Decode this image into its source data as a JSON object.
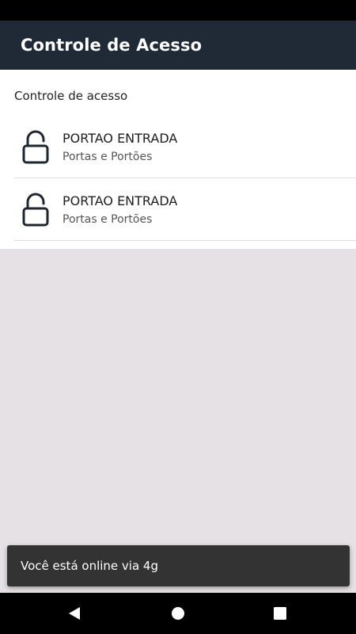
{
  "app_bar": {
    "title": "Controle de Acesso"
  },
  "section": {
    "header": "Controle de acesso"
  },
  "items": [
    {
      "title": "PORTAO ENTRADA",
      "subtitle": "Portas e Portões",
      "icon": "unlocked-padlock-icon"
    },
    {
      "title": "PORTAO ENTRADA",
      "subtitle": "Portas e Portões",
      "icon": "unlocked-padlock-icon"
    }
  ],
  "snackbar": {
    "message": "Você está online via 4g"
  },
  "nav": {
    "back": "back-icon",
    "home": "home-icon",
    "recents": "recents-icon"
  },
  "colors": {
    "app_bar": "#1f2a36",
    "background": "#e5e1e4",
    "snackbar": "#333333"
  }
}
